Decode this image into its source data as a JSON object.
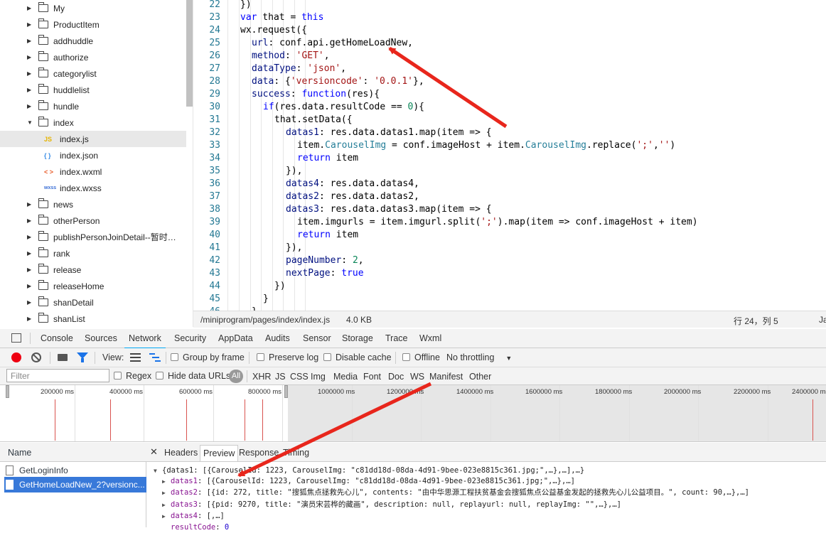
{
  "tree": {
    "folders_top": [
      "My",
      "ProductItem",
      "addhuddle",
      "authorize",
      "categorylist",
      "huddlelist",
      "hundle"
    ],
    "open_folder": "index",
    "files": [
      {
        "icon": "JS",
        "name": "index.js",
        "color": "#e6b400"
      },
      {
        "icon": "{ }",
        "name": "index.json",
        "color": "#3a8ee6"
      },
      {
        "icon": "< >",
        "name": "index.wxml",
        "color": "#e85d2a"
      },
      {
        "icon": "wxss",
        "name": "index.wxss",
        "color": "#3a6fd6"
      }
    ],
    "folders_bottom": [
      "news",
      "otherPerson",
      "publishPersonJoinDetail--暂时…",
      "rank",
      "release",
      "releaseHome",
      "shanDetail",
      "shanList"
    ]
  },
  "editor": {
    "lines": [
      {
        "n": "22",
        "t": "      })"
      },
      {
        "n": "23",
        "t": "      var that = this"
      },
      {
        "n": "24",
        "t": "      wx.request({"
      },
      {
        "n": "25",
        "t": "        url: conf.api.getHomeLoadNew,"
      },
      {
        "n": "26",
        "t": "        method: 'GET',"
      },
      {
        "n": "27",
        "t": "        dataType: 'json',"
      },
      {
        "n": "28",
        "t": "        data: {'versioncode': '0.0.1'},"
      },
      {
        "n": "29",
        "t": "        success: function(res){"
      },
      {
        "n": "30",
        "t": "          if(res.data.resultCode == 0){"
      },
      {
        "n": "31",
        "t": "            that.setData({"
      },
      {
        "n": "32",
        "t": "              datas1: res.data.datas1.map(item => {"
      },
      {
        "n": "33",
        "t": "                item.CarouselImg = conf.imageHost + item.CarouselImg.replace(';','')"
      },
      {
        "n": "34",
        "t": "                return item"
      },
      {
        "n": "35",
        "t": "              }),"
      },
      {
        "n": "36",
        "t": "              datas4: res.data.datas4,"
      },
      {
        "n": "37",
        "t": "              datas2: res.data.datas2,"
      },
      {
        "n": "38",
        "t": "              datas3: res.data.datas3.map(item => {"
      },
      {
        "n": "39",
        "t": "                item.imgurls = item.imgurl.split(';').map(item => conf.imageHost + item)"
      },
      {
        "n": "40",
        "t": "                return item"
      },
      {
        "n": "41",
        "t": "              }),"
      },
      {
        "n": "42",
        "t": "              pageNumber: 2,"
      },
      {
        "n": "43",
        "t": "              nextPage: true"
      },
      {
        "n": "44",
        "t": "            })"
      },
      {
        "n": "45",
        "t": "          }"
      },
      {
        "n": "46",
        "t": "        }"
      }
    ]
  },
  "status": {
    "path": "/miniprogram/pages/index/index.js",
    "size": "4.0 KB",
    "position": "行 24，列 5",
    "extra": "Ja"
  },
  "devtools": {
    "tabs": [
      "Console",
      "Sources",
      "Network",
      "Security",
      "AppData",
      "Audits",
      "Sensor",
      "Storage",
      "Trace",
      "Wxml"
    ],
    "active_tab": "Network",
    "toolbar": {
      "view": "View:",
      "group_by_frame": "Group by frame",
      "preserve_log": "Preserve log",
      "disable_cache": "Disable cache",
      "offline": "Offline",
      "throttling": "No throttling"
    },
    "filter": {
      "placeholder": "Filter",
      "regex": "Regex",
      "hide_data_urls": "Hide data URLs",
      "all": "All",
      "types": [
        "XHR",
        "JS",
        "CSS",
        "Img",
        "Media",
        "Font",
        "Doc",
        "WS",
        "Manifest",
        "Other"
      ]
    },
    "overview_labels": [
      "200000 ms",
      "400000 ms",
      "600000 ms",
      "800000 ms",
      "1000000 ms",
      "1200000 ms",
      "1400000 ms",
      "1600000 ms",
      "1800000 ms",
      "2000000 ms",
      "2200000 ms",
      "2400000 ms"
    ],
    "requests_header": "Name",
    "requests": [
      "GetLoginInfo",
      "GetHomeLoadNew_2?versionc..."
    ],
    "selected_request": 1,
    "detail_tabs": [
      "Headers",
      "Preview",
      "Response",
      "Timing"
    ],
    "active_detail_tab": "Preview",
    "preview": {
      "root": "{datas1: [{CarouselId: 1223, CarouselImg: \"c81dd18d-08da-4d91-9bee-023e8815c361.jpg;\",…},…],…}",
      "rows": [
        {
          "key": "datas1",
          "value": "[{CarouselId: 1223, CarouselImg: \"c81dd18d-08da-4d91-9bee-023e8815c361.jpg;\",…},…]"
        },
        {
          "key": "datas2",
          "value": "[{id: 272, title: \"搜狐焦点拯救先心儿\", contents: \"由中华思源工程扶贫基金会搜狐焦点公益基金发起的拯救先心儿公益项目。\", count: 90,…},…]"
        },
        {
          "key": "datas3",
          "value": "[{pid: 9270, title: \"演员宋芸桦的藏画\", description: null, replayurl: null, replayImg: \"\",…},…]"
        },
        {
          "key": "datas4",
          "value": "[,…]"
        },
        {
          "key": "resultCode",
          "value": "0"
        }
      ]
    }
  }
}
